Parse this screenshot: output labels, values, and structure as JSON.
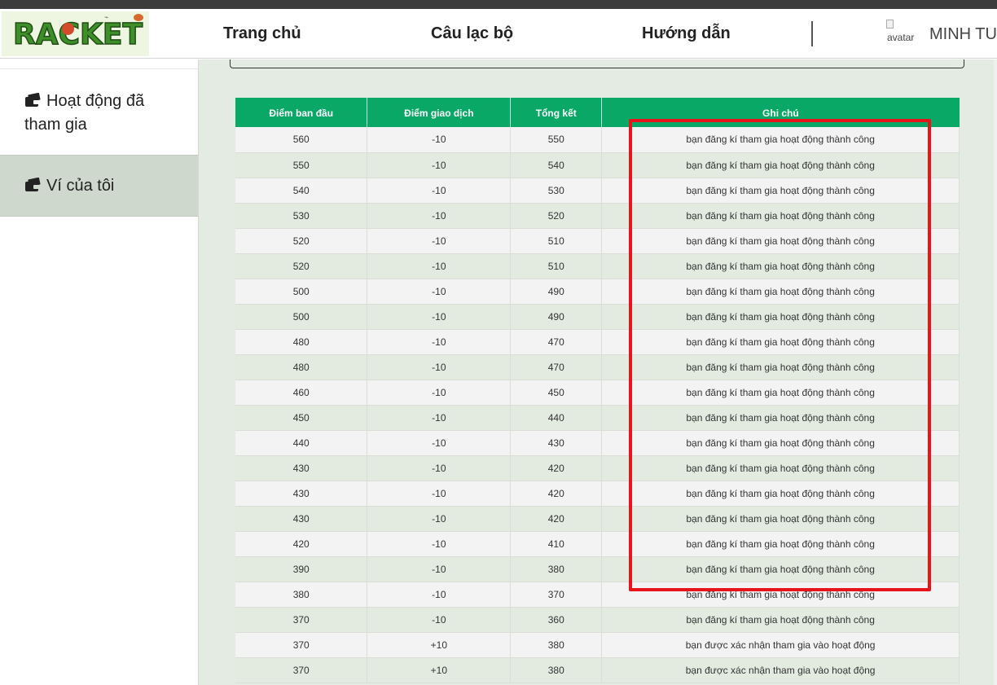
{
  "header": {
    "logo_text": "RACKET",
    "nav": [
      "Trang chủ",
      "Câu lạc bộ",
      "Hướng dẫn"
    ],
    "avatar_alt": "avatar",
    "username": "MINH TU"
  },
  "sidebar": {
    "items": [
      {
        "label": "Hoạt động đã tham gia",
        "icon": "wallet-icon"
      },
      {
        "label": "Ví của tôi",
        "icon": "wallet-icon"
      }
    ]
  },
  "colors": {
    "table_header": "#0aa866",
    "highlight_box": "#e8141c",
    "sidebar_active": "#cfd8cc",
    "content_bg": "#e4ebe2"
  },
  "table": {
    "headers": [
      "Điểm ban đầu",
      "Điểm giao dịch",
      "Tổng kết",
      "Ghi chú"
    ],
    "rows": [
      [
        "560",
        "-10",
        "550",
        "bạn đăng kí tham gia hoạt động thành công"
      ],
      [
        "550",
        "-10",
        "540",
        "bạn đăng kí tham gia hoạt động thành công"
      ],
      [
        "540",
        "-10",
        "530",
        "bạn đăng kí tham gia hoạt động thành công"
      ],
      [
        "530",
        "-10",
        "520",
        "bạn đăng kí tham gia hoạt động thành công"
      ],
      [
        "520",
        "-10",
        "510",
        "bạn đăng kí tham gia hoạt động thành công"
      ],
      [
        "520",
        "-10",
        "510",
        "bạn đăng kí tham gia hoạt động thành công"
      ],
      [
        "500",
        "-10",
        "490",
        "bạn đăng kí tham gia hoạt động thành công"
      ],
      [
        "500",
        "-10",
        "490",
        "bạn đăng kí tham gia hoạt động thành công"
      ],
      [
        "480",
        "-10",
        "470",
        "bạn đăng kí tham gia hoạt động thành công"
      ],
      [
        "480",
        "-10",
        "470",
        "bạn đăng kí tham gia hoạt động thành công"
      ],
      [
        "460",
        "-10",
        "450",
        "bạn đăng kí tham gia hoạt động thành công"
      ],
      [
        "450",
        "-10",
        "440",
        "bạn đăng kí tham gia hoạt động thành công"
      ],
      [
        "440",
        "-10",
        "430",
        "bạn đăng kí tham gia hoạt động thành công"
      ],
      [
        "430",
        "-10",
        "420",
        "bạn đăng kí tham gia hoạt động thành công"
      ],
      [
        "430",
        "-10",
        "420",
        "bạn đăng kí tham gia hoạt động thành công"
      ],
      [
        "430",
        "-10",
        "420",
        "bạn đăng kí tham gia hoạt động thành công"
      ],
      [
        "420",
        "-10",
        "410",
        "bạn đăng kí tham gia hoạt động thành công"
      ],
      [
        "390",
        "-10",
        "380",
        "bạn đăng kí tham gia hoạt động thành công"
      ],
      [
        "380",
        "-10",
        "370",
        "bạn đăng kí tham gia hoạt động thành công"
      ],
      [
        "370",
        "-10",
        "360",
        "bạn đăng kí tham gia hoạt động thành công"
      ],
      [
        "370",
        "+10",
        "380",
        "bạn được xác nhận tham gia vào hoạt động"
      ],
      [
        "370",
        "+10",
        "380",
        "bạn được xác nhận tham gia vào hoạt động"
      ]
    ]
  }
}
